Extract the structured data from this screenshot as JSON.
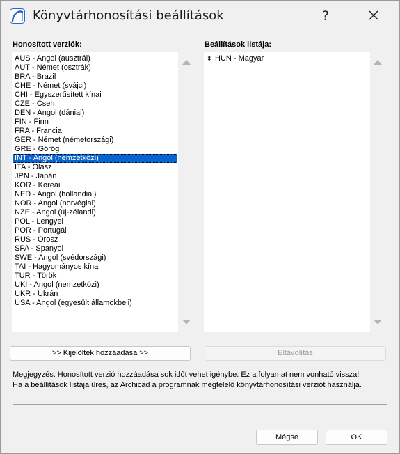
{
  "window": {
    "title": "Könyvtárhonosítási beállítások",
    "help_label": "?"
  },
  "left": {
    "label": "Honosított verziók:",
    "items": [
      "AUS - Angol (ausztrál)",
      "AUT - Német (osztrák)",
      "BRA - Brazil",
      "CHE - Német (svájci)",
      "CHI - Egyszerűsített kínai",
      "CZE - Cseh",
      "DEN - Angol (dániai)",
      "FIN - Finn",
      "FRA - Francia",
      "GER - Német (németországi)",
      "GRE - Görög",
      "INT - Angol (nemzetközi)",
      "ITA - Olasz",
      "JPN - Japán",
      "KOR - Koreai",
      "NED - Angol (hollandiai)",
      "NOR - Angol (norvégiai)",
      "NZE - Angol (új-zélandi)",
      "POL - Lengyel",
      "POR - Portugál",
      "RUS - Orosz",
      "SPA - Spanyol",
      "SWE - Angol (svédországi)",
      "TAI - Hagyományos kínai",
      "TUR - Török",
      "UKI - Angol (nemzetközi)",
      "UKR - Ukrán",
      "USA - Angol (egyesült államokbeli)"
    ],
    "selected": "INT - Angol (nemzetközi)",
    "add_button": ">> Kijelöltek hozzáadása >>"
  },
  "right": {
    "label": "Beállítások listája:",
    "items": [
      "HUN - Magyar"
    ],
    "drag_glyph": "⬍",
    "remove_button": "Eltávolítás"
  },
  "note": {
    "line1": "Megjegyzés: Honosított verzió hozzáadása sok időt vehet igénybe. Ez a folyamat nem vonható vissza!",
    "line2": "Ha a beállítások listája üres, az Archicad a programnak megfelelő könyvtárhonosítási verziót használja."
  },
  "footer": {
    "cancel_label": "Mégse",
    "ok_label": "OK"
  },
  "colors": {
    "selection": "#0a64d0",
    "window_bg": "#f0f0f0",
    "icon_blue": "#2a66c9"
  }
}
